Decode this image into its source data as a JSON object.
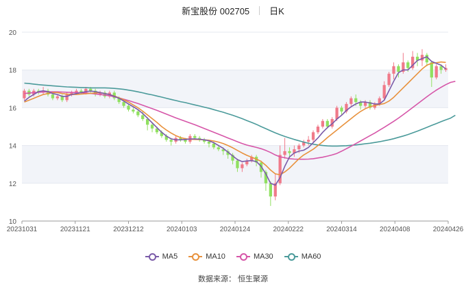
{
  "header": {
    "stock_name": "新宝股份 002705",
    "period": "日K"
  },
  "source_label": "数据来源：  恒生聚源",
  "colors": {
    "up": "#f07a8a",
    "down": "#90e060",
    "ma5": "#7a5aa8",
    "ma10": "#e8913c",
    "ma30": "#d655a8",
    "ma60": "#4a9a9a",
    "band": "#f2f4f9",
    "grid": "#e4e8ef"
  },
  "chart_data": {
    "type": "candlestick",
    "y_ticks": [
      "10",
      "12",
      "14",
      "16",
      "18",
      "20"
    ],
    "ylim": [
      10,
      20
    ],
    "x_ticks": [
      "20231031",
      "20231121",
      "20231212",
      "20240103",
      "20240124",
      "20240222",
      "20240314",
      "20240408",
      "20240426"
    ],
    "legend": [
      "MA5",
      "MA10",
      "MA30",
      "MA60"
    ],
    "candles": [
      [
        16.5,
        16.9,
        16.4,
        17.0
      ],
      [
        16.9,
        16.7,
        16.6,
        17.0
      ],
      [
        16.7,
        16.9,
        16.6,
        17.0
      ],
      [
        16.9,
        16.8,
        16.7,
        17.0
      ],
      [
        16.8,
        16.9,
        16.7,
        17.1
      ],
      [
        16.9,
        16.7,
        16.6,
        17.0
      ],
      [
        16.7,
        16.5,
        16.4,
        16.8
      ],
      [
        16.5,
        16.6,
        16.4,
        16.7
      ],
      [
        16.6,
        16.4,
        16.3,
        16.7
      ],
      [
        16.4,
        16.7,
        16.3,
        16.8
      ],
      [
        16.7,
        16.8,
        16.6,
        16.9
      ],
      [
        16.8,
        16.9,
        16.7,
        17.0
      ],
      [
        16.9,
        16.8,
        16.7,
        17.0
      ],
      [
        16.8,
        17.0,
        16.7,
        17.1
      ],
      [
        17.0,
        16.9,
        16.8,
        17.1
      ],
      [
        16.9,
        16.7,
        16.6,
        17.0
      ],
      [
        16.7,
        16.8,
        16.6,
        16.9
      ],
      [
        16.8,
        16.6,
        16.5,
        16.9
      ],
      [
        16.6,
        16.8,
        16.5,
        16.9
      ],
      [
        16.8,
        16.5,
        16.4,
        16.9
      ],
      [
        16.5,
        16.3,
        16.2,
        16.6
      ],
      [
        16.3,
        16.1,
        16.0,
        16.4
      ],
      [
        16.1,
        15.9,
        15.8,
        16.2
      ],
      [
        15.9,
        15.8,
        15.7,
        16.0
      ],
      [
        15.8,
        15.6,
        15.5,
        15.9
      ],
      [
        15.6,
        15.4,
        15.3,
        15.8
      ],
      [
        15.4,
        15.1,
        14.8,
        15.5
      ],
      [
        15.1,
        14.9,
        14.7,
        15.2
      ],
      [
        14.9,
        14.7,
        14.6,
        15.0
      ],
      [
        14.7,
        14.5,
        14.4,
        14.8
      ],
      [
        14.5,
        14.3,
        14.2,
        14.6
      ],
      [
        14.3,
        14.2,
        14.0,
        14.4
      ],
      [
        14.2,
        14.4,
        14.1,
        14.5
      ],
      [
        14.4,
        14.3,
        14.2,
        14.5
      ],
      [
        14.3,
        14.2,
        14.1,
        14.4
      ],
      [
        14.2,
        14.5,
        14.1,
        14.6
      ],
      [
        14.5,
        14.4,
        14.3,
        14.6
      ],
      [
        14.4,
        14.3,
        14.2,
        14.5
      ],
      [
        14.3,
        14.2,
        14.1,
        14.4
      ],
      [
        14.2,
        14.1,
        13.9,
        14.3
      ],
      [
        14.1,
        13.9,
        13.8,
        14.2
      ],
      [
        13.9,
        13.8,
        13.7,
        14.0
      ],
      [
        13.8,
        13.7,
        13.5,
        13.9
      ],
      [
        13.7,
        13.5,
        13.3,
        13.8
      ],
      [
        13.5,
        13.2,
        13.0,
        13.6
      ],
      [
        13.2,
        12.8,
        12.6,
        13.3
      ],
      [
        12.8,
        13.0,
        12.6,
        13.1
      ],
      [
        13.0,
        13.2,
        12.9,
        13.3
      ],
      [
        13.2,
        13.4,
        13.1,
        13.5
      ],
      [
        13.4,
        13.1,
        12.9,
        13.5
      ],
      [
        13.1,
        12.6,
        12.3,
        13.2
      ],
      [
        12.6,
        12.0,
        11.6,
        12.7
      ],
      [
        12.0,
        11.3,
        10.8,
        12.1
      ],
      [
        11.3,
        12.0,
        11.1,
        12.5
      ],
      [
        12.0,
        13.5,
        11.9,
        14.0
      ],
      [
        13.5,
        13.7,
        13.3,
        14.4
      ],
      [
        13.7,
        13.6,
        13.3,
        13.9
      ],
      [
        13.6,
        13.8,
        13.4,
        14.0
      ],
      [
        13.8,
        14.0,
        13.6,
        14.1
      ],
      [
        14.0,
        14.2,
        13.9,
        14.3
      ],
      [
        14.2,
        14.3,
        14.0,
        14.5
      ],
      [
        14.3,
        14.7,
        14.2,
        14.8
      ],
      [
        14.7,
        15.0,
        14.6,
        15.1
      ],
      [
        15.0,
        15.3,
        14.9,
        15.4
      ],
      [
        15.3,
        15.0,
        14.9,
        15.4
      ],
      [
        15.0,
        15.4,
        14.9,
        15.5
      ],
      [
        15.4,
        16.0,
        15.3,
        16.1
      ],
      [
        16.0,
        15.8,
        15.6,
        16.1
      ],
      [
        15.8,
        16.2,
        15.7,
        16.3
      ],
      [
        16.2,
        16.5,
        16.1,
        16.6
      ],
      [
        16.5,
        16.3,
        16.1,
        16.7
      ],
      [
        16.3,
        16.1,
        15.9,
        16.4
      ],
      [
        16.1,
        16.3,
        16.0,
        16.4
      ],
      [
        16.3,
        16.0,
        15.9,
        16.4
      ],
      [
        16.0,
        16.2,
        15.9,
        16.3
      ],
      [
        16.2,
        16.5,
        16.1,
        16.6
      ],
      [
        16.5,
        17.2,
        16.4,
        17.4
      ],
      [
        17.2,
        17.8,
        17.1,
        17.9
      ],
      [
        17.8,
        18.2,
        17.5,
        18.4
      ],
      [
        18.2,
        17.9,
        17.6,
        18.3
      ],
      [
        17.9,
        18.4,
        17.8,
        18.9
      ],
      [
        18.4,
        18.1,
        17.9,
        18.5
      ],
      [
        18.1,
        18.7,
        18.0,
        19.0
      ],
      [
        18.7,
        18.5,
        18.2,
        18.9
      ],
      [
        18.5,
        18.8,
        18.2,
        19.1
      ],
      [
        18.8,
        18.4,
        18.2,
        18.9
      ],
      [
        18.4,
        17.6,
        17.1,
        18.5
      ],
      [
        17.6,
        18.2,
        17.5,
        18.3
      ],
      [
        18.2,
        18.0,
        17.8,
        18.3
      ],
      [
        18.0,
        18.1,
        17.9,
        18.3
      ]
    ],
    "ma5": [
      16.35,
      16.55,
      16.7,
      16.85,
      16.9,
      16.85,
      16.75,
      16.7,
      16.6,
      16.6,
      16.7,
      16.75,
      16.8,
      16.85,
      16.88,
      16.85,
      16.8,
      16.75,
      16.7,
      16.6,
      16.5,
      16.35,
      16.2,
      16.05,
      15.9,
      15.7,
      15.45,
      15.2,
      14.95,
      14.7,
      14.5,
      14.35,
      14.3,
      14.3,
      14.32,
      14.34,
      14.35,
      14.33,
      14.3,
      14.25,
      14.15,
      14.0,
      13.85,
      13.65,
      13.45,
      13.25,
      13.15,
      13.18,
      13.2,
      13.15,
      12.9,
      12.5,
      12.0,
      11.9,
      12.3,
      12.9,
      13.4,
      13.6,
      13.7,
      13.75,
      13.9,
      14.15,
      14.4,
      14.7,
      14.95,
      15.15,
      15.4,
      15.6,
      15.85,
      16.05,
      16.2,
      16.3,
      16.3,
      16.25,
      16.2,
      16.2,
      16.4,
      16.9,
      17.4,
      17.85,
      18.0,
      18.0,
      18.25,
      18.5,
      18.6,
      18.7,
      18.45,
      18.35,
      18.25,
      18.05
    ],
    "ma10": [
      16.3,
      16.4,
      16.5,
      16.6,
      16.7,
      16.75,
      16.8,
      16.8,
      16.75,
      16.72,
      16.7,
      16.7,
      16.72,
      16.74,
      16.76,
      16.78,
      16.8,
      16.75,
      16.7,
      16.62,
      16.52,
      16.42,
      16.3,
      16.15,
      16.0,
      15.82,
      15.62,
      15.42,
      15.22,
      15.0,
      14.82,
      14.66,
      14.52,
      14.42,
      14.36,
      14.33,
      14.32,
      14.31,
      14.3,
      14.28,
      14.24,
      14.18,
      14.1,
      14.0,
      13.88,
      13.74,
      13.6,
      13.48,
      13.38,
      13.28,
      13.16,
      12.95,
      12.7,
      12.5,
      12.45,
      12.6,
      12.8,
      13.05,
      13.3,
      13.5,
      13.65,
      13.8,
      14.0,
      14.2,
      14.42,
      14.62,
      14.82,
      15.02,
      15.22,
      15.42,
      15.62,
      15.8,
      15.95,
      16.05,
      16.12,
      16.17,
      16.22,
      16.35,
      16.55,
      16.8,
      17.05,
      17.3,
      17.55,
      17.8,
      18.05,
      18.25,
      18.35,
      18.38,
      18.42,
      18.4
    ],
    "ma30": [
      16.75,
      16.78,
      16.8,
      16.82,
      16.83,
      16.84,
      16.84,
      16.84,
      16.83,
      16.82,
      16.81,
      16.8,
      16.79,
      16.78,
      16.76,
      16.73,
      16.7,
      16.67,
      16.63,
      16.58,
      16.52,
      16.45,
      16.38,
      16.3,
      16.22,
      16.13,
      16.04,
      15.95,
      15.86,
      15.76,
      15.66,
      15.56,
      15.46,
      15.37,
      15.28,
      15.19,
      15.1,
      15.0,
      14.9,
      14.8,
      14.7,
      14.6,
      14.5,
      14.4,
      14.3,
      14.2,
      14.1,
      14.02,
      13.96,
      13.9,
      13.83,
      13.74,
      13.63,
      13.5,
      13.4,
      13.35,
      13.3,
      13.28,
      13.27,
      13.27,
      13.28,
      13.3,
      13.34,
      13.38,
      13.44,
      13.5,
      13.58,
      13.7,
      13.83,
      13.96,
      14.1,
      14.24,
      14.38,
      14.52,
      14.66,
      14.81,
      14.96,
      15.12,
      15.28,
      15.45,
      15.63,
      15.82,
      16.01,
      16.2,
      16.39,
      16.58,
      16.76,
      16.93,
      17.08,
      17.22,
      17.34,
      17.4
    ],
    "ma60": [
      17.3,
      17.28,
      17.25,
      17.22,
      17.2,
      17.18,
      17.16,
      17.14,
      17.12,
      17.1,
      17.09,
      17.08,
      17.07,
      17.06,
      17.05,
      17.05,
      17.05,
      17.05,
      17.04,
      17.02,
      17.0,
      16.97,
      16.93,
      16.89,
      16.84,
      16.79,
      16.73,
      16.68,
      16.62,
      16.56,
      16.5,
      16.44,
      16.38,
      16.32,
      16.27,
      16.21,
      16.15,
      16.09,
      16.03,
      15.97,
      15.9,
      15.83,
      15.76,
      15.68,
      15.6,
      15.51,
      15.42,
      15.32,
      15.22,
      15.12,
      15.0,
      14.89,
      14.78,
      14.67,
      14.57,
      14.48,
      14.4,
      14.32,
      14.25,
      14.18,
      14.12,
      14.07,
      14.03,
      14.0,
      13.98,
      13.97,
      13.97,
      13.98,
      13.99,
      14.01,
      14.03,
      14.06,
      14.09,
      14.12,
      14.16,
      14.2,
      14.25,
      14.3,
      14.36,
      14.43,
      14.5,
      14.58,
      14.67,
      14.76,
      14.86,
      14.96,
      15.06,
      15.16,
      15.26,
      15.36,
      15.45,
      15.6
    ]
  }
}
